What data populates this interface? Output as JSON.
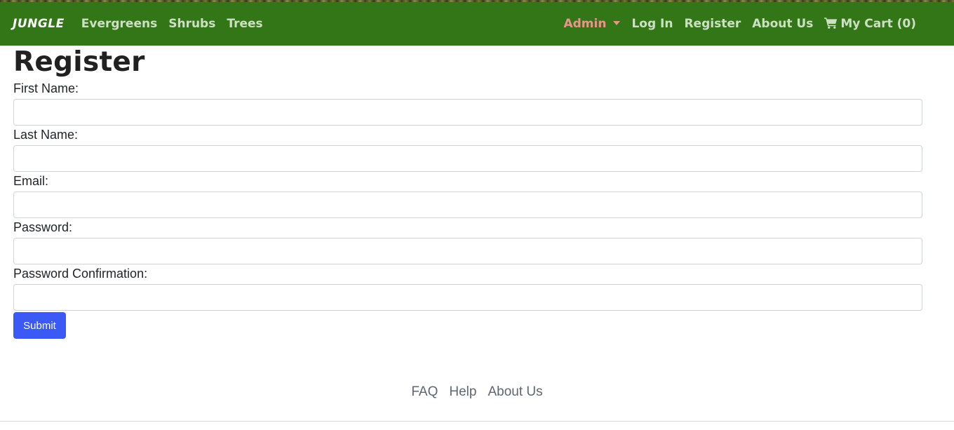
{
  "nav": {
    "brand": "JUNGLE",
    "left_links": [
      "Evergreens",
      "Shrubs",
      "Trees"
    ],
    "admin": "Admin",
    "login": "Log In",
    "register": "Register",
    "about": "About Us",
    "cart": "My Cart (0)",
    "cart_icon": "shopping-cart-icon"
  },
  "form": {
    "title": "Register",
    "first_name_label": "First Name:",
    "last_name_label": "Last Name:",
    "email_label": "Email:",
    "password_label": "Password:",
    "password_confirmation_label": "Password Confirmation:",
    "submit_label": "Submit"
  },
  "footer": {
    "links": [
      "FAQ",
      "Help",
      "About Us"
    ]
  },
  "colors": {
    "navbar": "#337617",
    "nav_link": "#cde0c3",
    "admin_link": "#e7968a",
    "submit_button": "#3b5af5"
  }
}
